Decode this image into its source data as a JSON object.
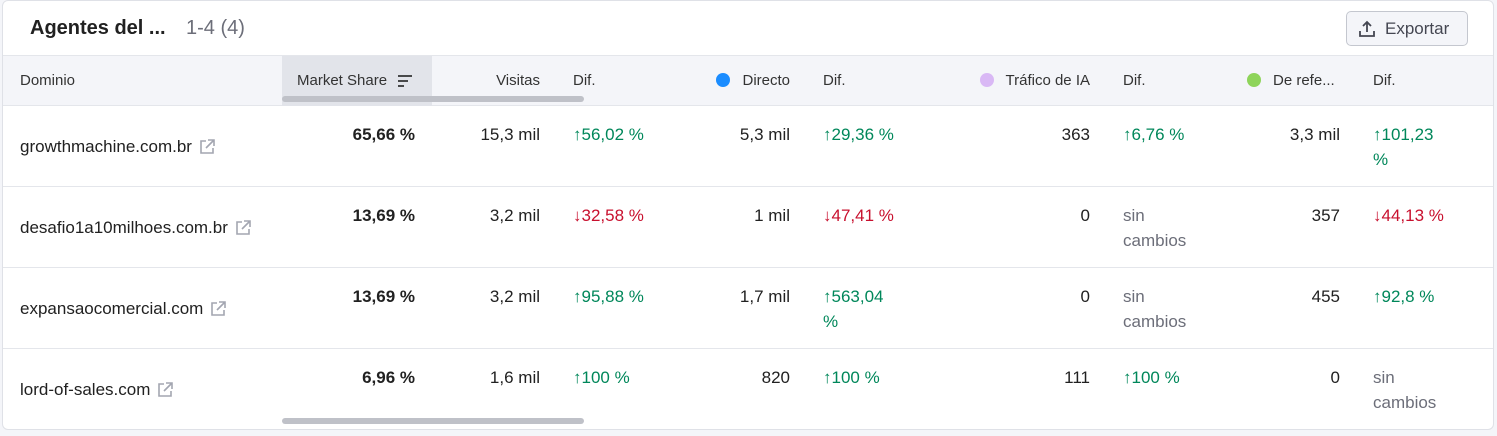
{
  "header": {
    "title": "Agentes del ...",
    "count": "1-4 (4)",
    "export_label": "Exportar"
  },
  "colors": {
    "directo": "#1a8cff",
    "trafico_ia": "#d9b8f5",
    "referencia": "#8ed45a",
    "positive": "#00875a",
    "negative": "#c8102e"
  },
  "columns": {
    "dominio": "Dominio",
    "market_share": "Market Share",
    "visitas": "Visitas",
    "dif1": "Dif.",
    "directo": "Directo",
    "dif2": "Dif.",
    "trafico_ia": "Tráfico de IA",
    "dif3": "Dif.",
    "referencia": "De refe...",
    "dif4": "Dif."
  },
  "rows": [
    {
      "domain": "growthmachine.com.br",
      "market_share": "65,66 %",
      "visitas": "15,3 mil",
      "dif_visitas": "↑56,02 %",
      "directo": "5,3 mil",
      "dif_directo": "↑29,36 %",
      "trafico_ia": "363",
      "dif_trafico_ia": "↑6,76 %",
      "referencia": "3,3 mil",
      "dif_referencia_a": "↑101,23",
      "dif_referencia_b": "%"
    },
    {
      "domain": "desafio1a10milhoes.com.br",
      "market_share": "13,69 %",
      "visitas": "3,2 mil",
      "dif_visitas": "↓32,58 %",
      "directo": "1 mil",
      "dif_directo": "↓47,41 %",
      "trafico_ia": "0",
      "dif_trafico_ia_a": "sin",
      "dif_trafico_ia_b": "cambios",
      "referencia": "357",
      "dif_referencia": "↓44,13 %"
    },
    {
      "domain": "expansaocomercial.com",
      "market_share": "13,69 %",
      "visitas": "3,2 mil",
      "dif_visitas": "↑95,88 %",
      "directo": "1,7 mil",
      "dif_directo_a": "↑563,04",
      "dif_directo_b": "%",
      "trafico_ia": "0",
      "dif_trafico_ia_a": "sin",
      "dif_trafico_ia_b": "cambios",
      "referencia": "455",
      "dif_referencia": "↑92,8 %"
    },
    {
      "domain": "lord-of-sales.com",
      "market_share": "6,96 %",
      "visitas": "1,6 mil",
      "dif_visitas": "↑100 %",
      "directo": "820",
      "dif_directo": "↑100 %",
      "trafico_ia": "111",
      "dif_trafico_ia": "↑100 %",
      "referencia": "0",
      "dif_referencia_a": "sin",
      "dif_referencia_b": "cambios"
    }
  ]
}
